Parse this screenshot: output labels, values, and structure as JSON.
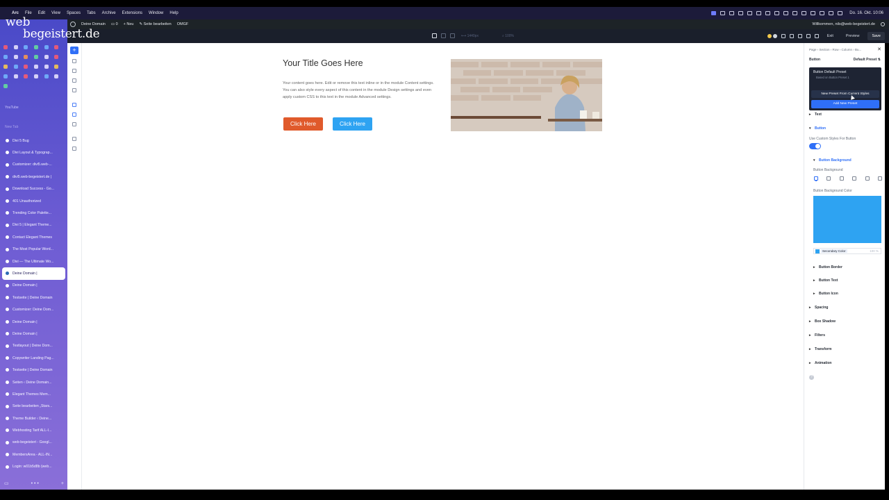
{
  "menubar": {
    "apple": "",
    "items": [
      "Arc",
      "File",
      "Edit",
      "View",
      "Spaces",
      "Tabs",
      "Archive",
      "Extensions",
      "Window",
      "Help"
    ],
    "datetime": "Do. 16. Okt. 10:06"
  },
  "logo": {
    "line1": "web",
    "line2": "begeistert.de"
  },
  "sidebar": {
    "label_youtube": "YouTube",
    "label_newtab": "New Tab",
    "tabs": [
      {
        "label": "Divi 5 Bug"
      },
      {
        "label": "Divi Layout & Typograp..."
      },
      {
        "label": "Customizer: divi5.web-..."
      },
      {
        "label": "divi5.web-begeistert.de |"
      },
      {
        "label": "Download Success - Go..."
      },
      {
        "label": "401 Unauthorized"
      },
      {
        "label": "Trending Color Palette..."
      },
      {
        "label": "Divi 5 | Elegant Theme..."
      },
      {
        "label": "Contact Elegant Themes"
      },
      {
        "label": "The Most Popular Word..."
      },
      {
        "label": "Divi — The Ultimate Wo..."
      },
      {
        "label": "Deine Domain |",
        "active": true
      },
      {
        "label": "Deine Domain |"
      },
      {
        "label": "Testseite | Deine Domain"
      },
      {
        "label": "Customizer: Deine Dom..."
      },
      {
        "label": "Deine Domain |"
      },
      {
        "label": "Deine Domain |"
      },
      {
        "label": "Testlayout | Deine Dom..."
      },
      {
        "label": "Copywriter Landing Pag..."
      },
      {
        "label": "Testseite | Deine Domain"
      },
      {
        "label": "Seiten ‹ Deine Domain..."
      },
      {
        "label": "Elegant Themes Mem..."
      },
      {
        "label": "Seite bearbeiten „Stars..."
      },
      {
        "label": "Theme Builder ‹ Deine..."
      },
      {
        "label": "Webhosting Tarif ALL-I..."
      },
      {
        "label": "web-begeistert - Googl..."
      },
      {
        "label": "MembersArea - ALL-IN..."
      },
      {
        "label": "Login: w01b5d8b (web..."
      }
    ]
  },
  "wpbar": {
    "site": "Deine Domain",
    "comments": "0",
    "new": "Neu",
    "edit": "Seite bearbeiten",
    "omgf": "OMGF",
    "greeting": "Willkommen, nils@web-begeistert.de"
  },
  "divibar": {
    "dimensions": "1440px",
    "zoom": "100%",
    "exit": "Exit",
    "preview": "Preview",
    "save": "Save"
  },
  "canvas": {
    "title": "Your Title Goes Here",
    "body": "Your content goes here. Edit or remove this text inline or in the module Content settings. You can also style every aspect of this content in the module Design settings and even apply custom CSS to this text in the module Advanced settings.",
    "button1": "Click Here",
    "button2": "Click Here",
    "button1_color": "#e05a2b",
    "button2_color": "#2ea3f2"
  },
  "panel": {
    "breadcrumb": "Page › Section › Row › Column › Bu...",
    "title": "Button",
    "preset": "Default Preset",
    "dropdown": {
      "heading": "Button Default Preset",
      "subheading": "Based on Button Preset 1",
      "new_preset": "New Preset From Current Styles",
      "add_new": "Add New Preset"
    },
    "text_section": "Text",
    "button_section": "Button",
    "custom_styles_label": "Use Custom Styles For Button",
    "bg_group": "Button Background",
    "bg_label": "Button Background",
    "bg_color_label": "Button Background Color",
    "bg_color": "#2ea3f2",
    "color_name": "Secondary Color",
    "color_pct": "100",
    "color_pct_unit": "%",
    "groups": [
      "Button Border",
      "Button Text",
      "Button Icon"
    ],
    "sections": [
      "Spacing",
      "Box Shadow",
      "Filters",
      "Transform",
      "Animation"
    ],
    "help": "?"
  }
}
